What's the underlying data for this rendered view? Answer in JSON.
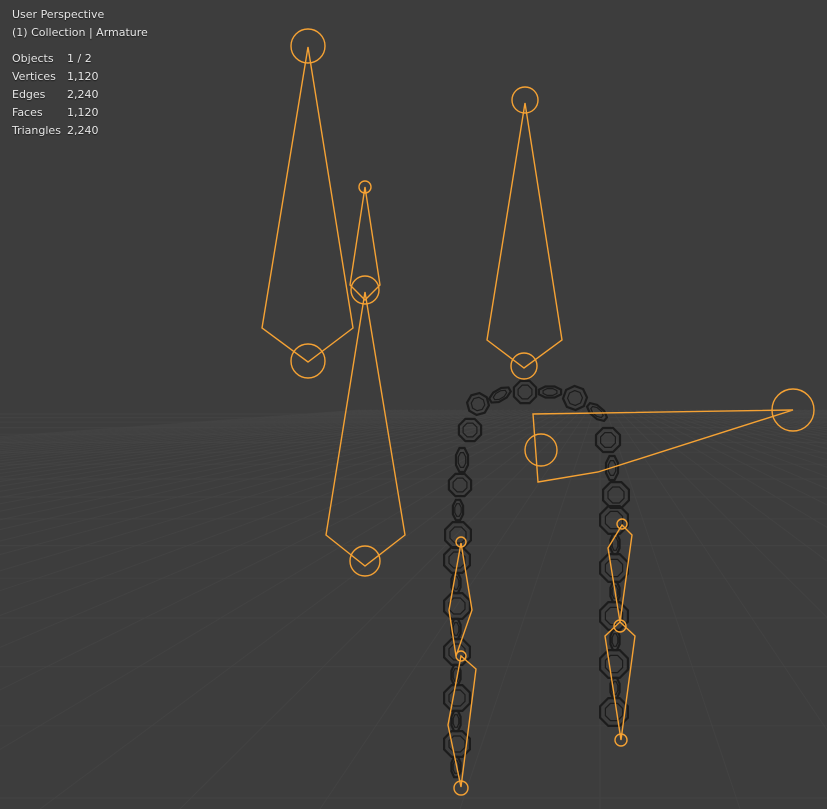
{
  "overlay": {
    "view_name": "User Perspective",
    "collection_path": "(1) Collection | Armature"
  },
  "stats": [
    {
      "label": "Objects",
      "value": "1 / 2"
    },
    {
      "label": "Vertices",
      "value": "1,120"
    },
    {
      "label": "Edges",
      "value": "2,240"
    },
    {
      "label": "Faces",
      "value": "1,120"
    },
    {
      "label": "Triangles",
      "value": "2,240"
    }
  ],
  "colors": {
    "background": "#3d3d3d",
    "grid": "#474747",
    "bone": "#f5a234",
    "chain": "#1c1c1c"
  }
}
